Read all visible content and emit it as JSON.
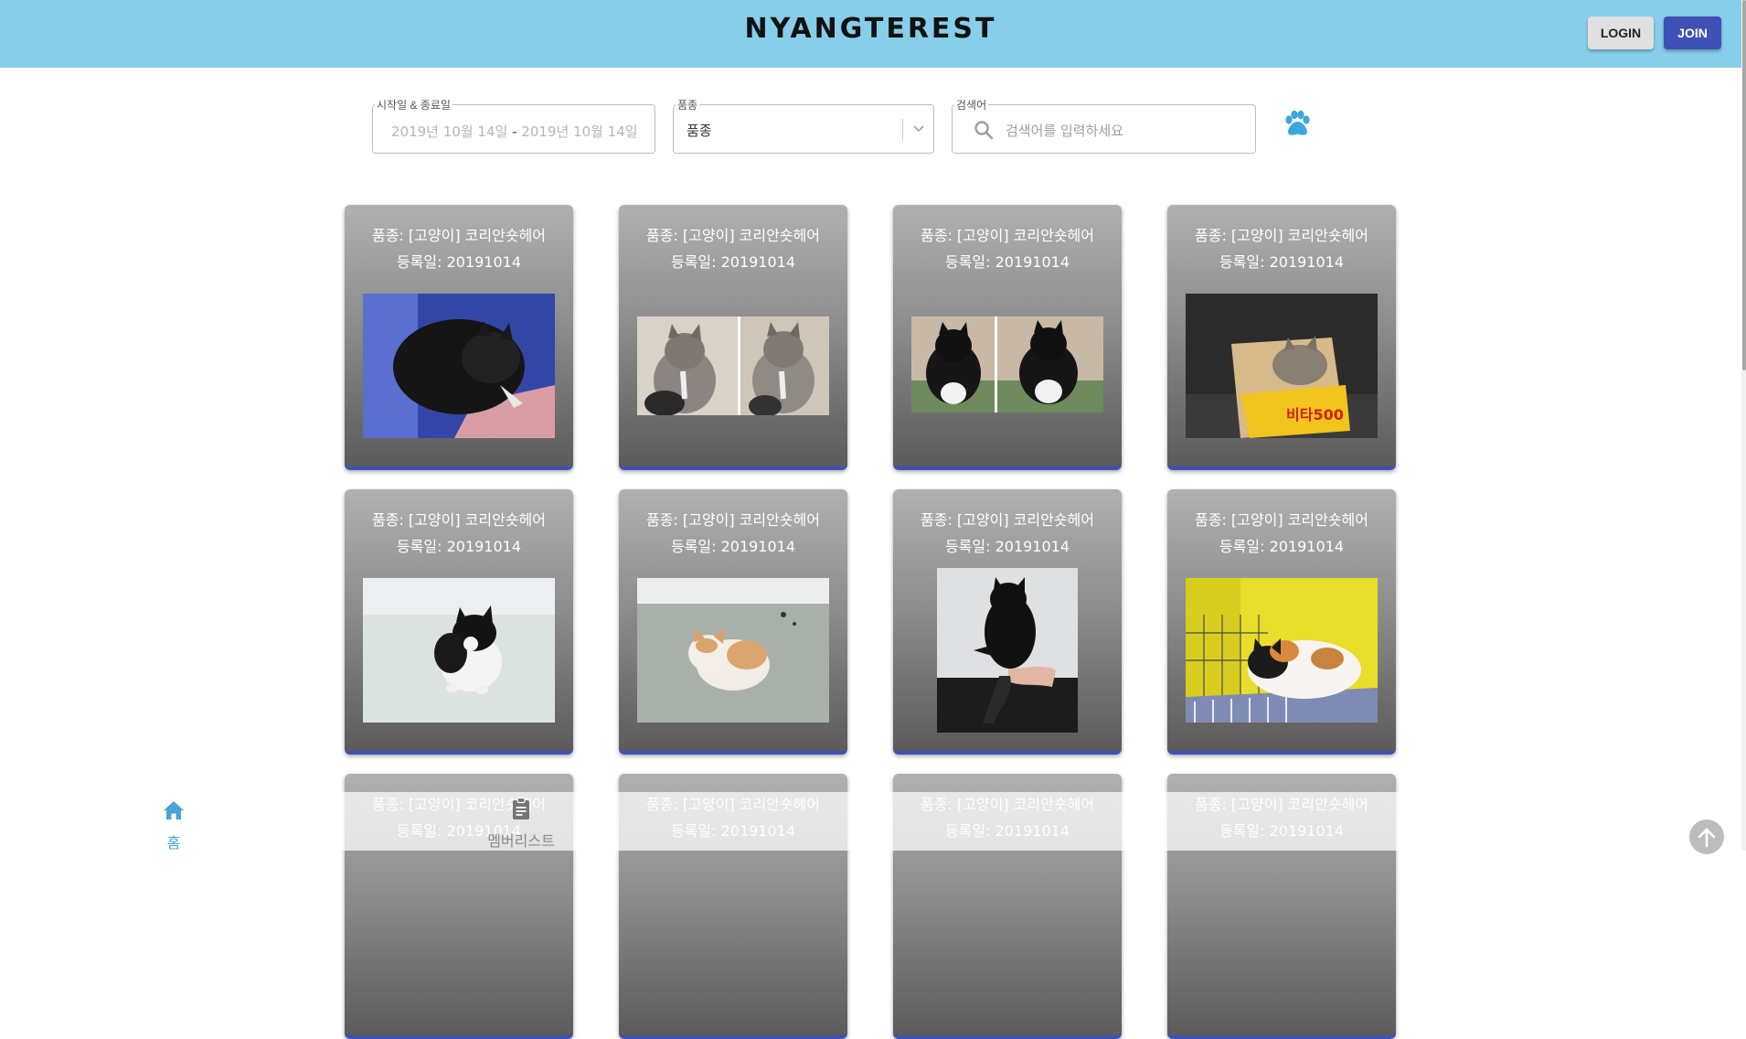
{
  "header": {
    "logo": "NYANGTEREST",
    "login_label": "LOGIN",
    "join_label": "JOIN",
    "bg_color": "#87ceeb",
    "join_color": "#3f51b5"
  },
  "filters": {
    "date_range": {
      "legend": "시작일 & 종료일",
      "start": "2019년 10월 14일",
      "separator": "-",
      "end": "2019년 10월 14일"
    },
    "breed": {
      "legend": "품종",
      "value": "품종"
    },
    "search": {
      "legend": "검색어",
      "placeholder": "검색어를 입력하세요"
    }
  },
  "cards": [
    {
      "breed": "품종: [고양이] 코리안숏헤어",
      "date": "등록일: 20191014",
      "photo": "black-kitten-in-hand"
    },
    {
      "breed": "품종: [고양이] 코리안숏헤어",
      "date": "등록일: 20191014",
      "photo": "two-tabby-kittens"
    },
    {
      "breed": "품종: [고양이] 코리안숏헤어",
      "date": "등록일: 20191014",
      "photo": "two-black-white-kittens"
    },
    {
      "breed": "품종: [고양이] 코리안숏헤어",
      "date": "등록일: 20191014",
      "photo": "kitten-in-box"
    },
    {
      "breed": "품종: [고양이] 코리안숏헤어",
      "date": "등록일: 20191014",
      "photo": "black-white-kitten-floor"
    },
    {
      "breed": "품종: [고양이] 코리안숏헤어",
      "date": "등록일: 20191014",
      "photo": "orange-white-kitten-floor"
    },
    {
      "breed": "품종: [고양이] 코리안숏헤어",
      "date": "등록일: 20191014",
      "photo": "black-kitten-held-up"
    },
    {
      "breed": "품종: [고양이] 코리안숏헤어",
      "date": "등록일: 20191014",
      "photo": "calico-cat-in-cage"
    },
    {
      "breed": "품종: [고양이] 코리안숏헤어",
      "date": "등록일: 20191014",
      "photo": ""
    },
    {
      "breed": "품종: [고양이] 코리안숏헤어",
      "date": "등록일: 20191014",
      "photo": ""
    },
    {
      "breed": "품종: [고양이] 코리안숏헤어",
      "date": "등록일: 20191014",
      "photo": ""
    },
    {
      "breed": "품종: [고양이] 코리안숏헤어",
      "date": "등록일: 20191014",
      "photo": ""
    }
  ],
  "bottom_nav": {
    "home_label": "홈",
    "members_label": "멤버리스트",
    "home_icon": "home-icon",
    "members_icon": "clipboard-icon",
    "active_color": "#4aa3d8"
  },
  "scroll_top_icon": "arrow-up-icon"
}
